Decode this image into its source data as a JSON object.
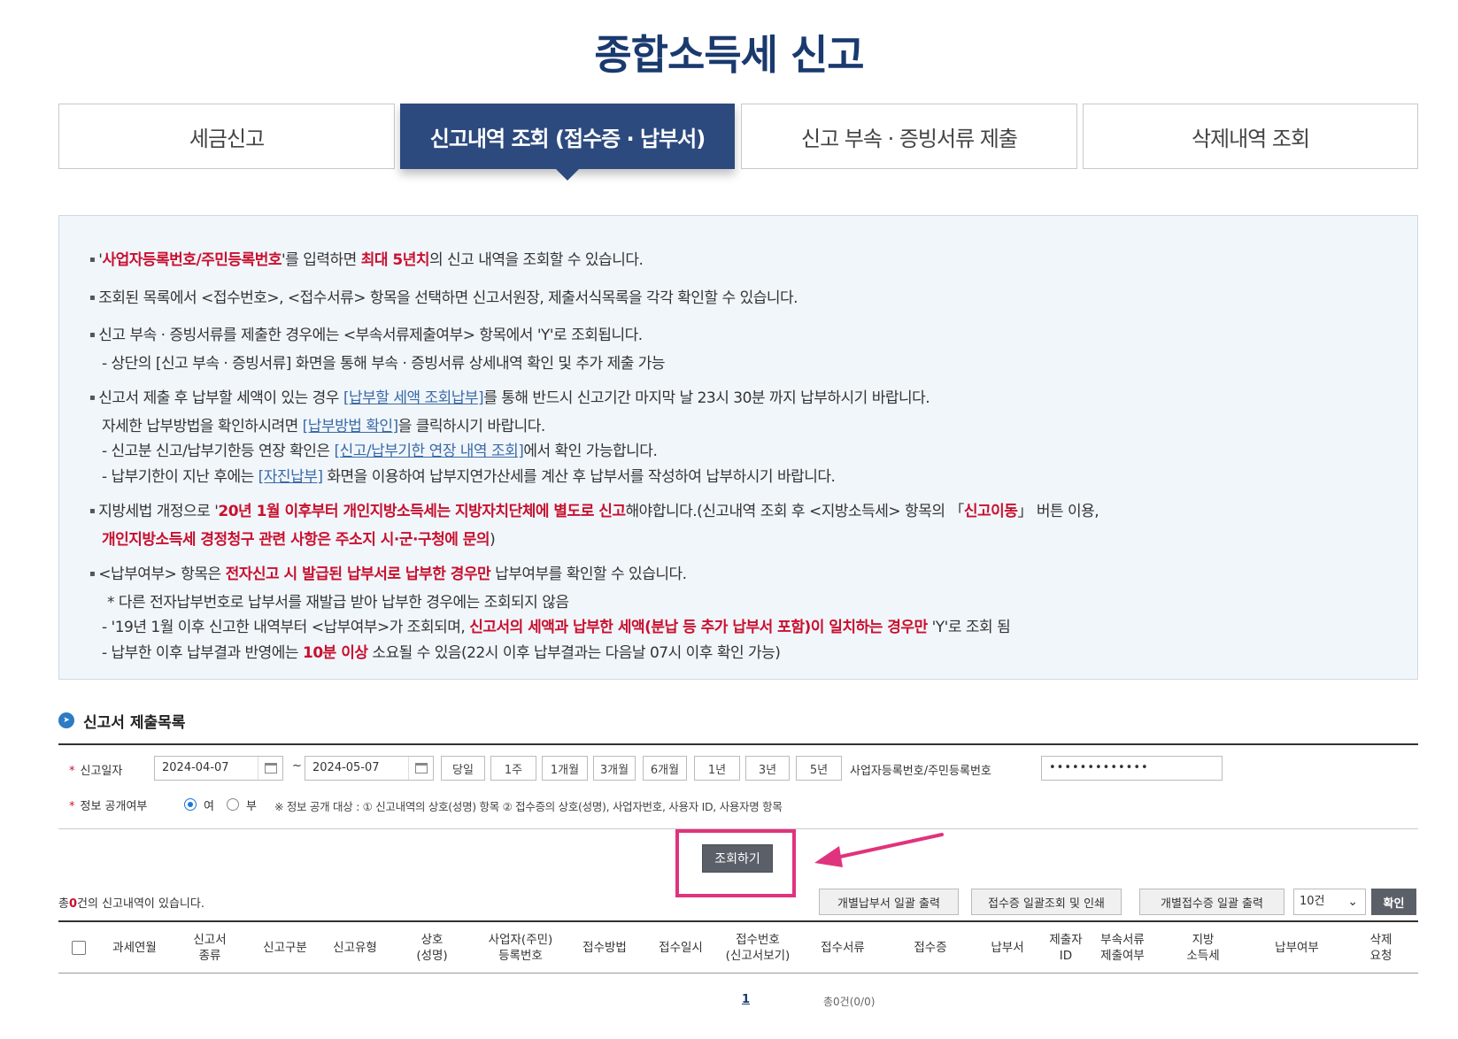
{
  "title": "종합소득세 신고",
  "tabs": [
    {
      "label": "세금신고"
    },
    {
      "label": "신고내역 조회 (접수증 · 납부서)"
    },
    {
      "label": "신고 부속 · 증빙서류 제출"
    },
    {
      "label": "삭제내역 조회"
    }
  ],
  "notice": {
    "l1a": "'",
    "l1b": "사업자등록번호/주민등록번호",
    "l1c": "'를 입력하면 ",
    "l1d": "최대 5년치",
    "l1e": "의 신고 내역을 조회할 수 있습니다.",
    "l2": "조회된 목록에서 <접수번호>, <접수서류> 항목을 선택하면 신고서원장, 제출서식목록을 각각 확인할 수 있습니다.",
    "l3": "신고 부속 · 증빙서류를 제출한 경우에는 <부속서류제출여부> 항목에서 'Y'로 조회됩니다.",
    "l4": "- 상단의 [신고 부속 · 증빙서류] 화면을 통해 부속 · 증빙서류 상세내역 확인 및 추가 제출 가능",
    "l5a": "신고서 제출 후 납부할 세액이 있는 경우 ",
    "l5b": "[납부할 세액 조회납부]",
    "l5c": "를 통해 반드시 신고기간 마지막 날 23시 30분 까지 납부하시기 바랍니다.",
    "l6a": "자세한 납부방법을 확인하시려면 ",
    "l6b": "[납부방법 확인]",
    "l6c": "을 클릭하시기 바랍니다.",
    "l7a": "- 신고분 신고/납부기한등 연장 확인은 ",
    "l7b": "[신고/납부기한 연장 내역 조회]",
    "l7c": "에서 확인 가능합니다.",
    "l8a": "- 납부기한이 지난 후에는 ",
    "l8b": "[자진납부]",
    "l8c": " 화면을 이용하여 납부지연가산세를 계산 후 납부서를 작성하여 납부하시기 바랍니다.",
    "l9a": "지방세법 개정으로 '",
    "l9b": "20년 1월 이후부터 개인지방소득세는 지방자치단체에 별도로 신고",
    "l9c": "해야합니다.(신고내역 조회 후 <지방소득세> 항목의 「",
    "l9d": "신고이동",
    "l9e": "」 버튼 이용,",
    "l10a": "개인지방소득세 경정청구 관련 사항은 주소지 시·군·구청에 문의",
    "l10b": ")",
    "l11a": "<납부여부> 항목은 ",
    "l11b": "전자신고 시 발급된 납부서로 납부한 경우만",
    "l11c": " 납부여부를 확인할 수 있습니다.",
    "l12": "* 다른 전자납부번호로 납부서를 재발급 받아 납부한 경우에는 조회되지 않음",
    "l13a": "- '19년 1월 이후 신고한 내역부터 <납부여부>가 조회되며, ",
    "l13b": "신고서의 세액과 납부한 세액(분납 등 추가 납부서 포함)이 일치하는 경우만",
    "l13c": " 'Y'로 조회 됨",
    "l14a": "- 납부한 이후 납부결과 반영에는 ",
    "l14b": "10분 이상",
    "l14c": " 소요될 수 있음(22시 이후 납부결과는 다음날 07시 이후 확인 가능)"
  },
  "section_title": "신고서 제출목록",
  "search": {
    "date_label": "신고일자",
    "date_from": "2024-04-07",
    "tilde": "~",
    "date_to": "2024-05-07",
    "periods": [
      "당일",
      "1주",
      "1개월",
      "3개월",
      "6개월",
      "1년",
      "3년",
      "5년"
    ],
    "id_label": "사업자등록번호/주민등록번호",
    "id_value": "•••••••••••••",
    "public_label": "정보 공개여부",
    "yes": "여",
    "no": "부",
    "info": "※ 정보 공개 대상 : ① 신고내역의 상호(성명) 항목 ② 접수증의 상호(성명), 사업자번호, 사용자 ID, 사용자명 항목"
  },
  "query_button": "조회하기",
  "result": {
    "prefix": "총",
    "count": "0",
    "suffix": "건의 신고내역이 있습니다."
  },
  "actions": [
    "개별납부서 일괄 출력",
    "접수증 일괄조회 및 인쇄",
    "개별접수증 일괄 출력"
  ],
  "page_size": "10건",
  "ok_button": "확인",
  "columns": [
    "과세연월",
    "신고서\n종류",
    "신고구분",
    "신고유형",
    "상호\n(성명)",
    "사업자(주민)\n등록번호",
    "접수방법",
    "접수일시",
    "접수번호\n(신고서보기)",
    "접수서류",
    "접수증",
    "납부서",
    "제출자\nID",
    "부속서류\n제출여부",
    "지방\n소득세",
    "납부여부",
    "삭제\n요청"
  ],
  "pager": {
    "page": "1",
    "total": "총0건(0/0)"
  },
  "colors": {
    "navy": "#2c4a7e",
    "title": "#1a3a6e",
    "red": "#c8102e",
    "highlight": "#e0337d"
  }
}
